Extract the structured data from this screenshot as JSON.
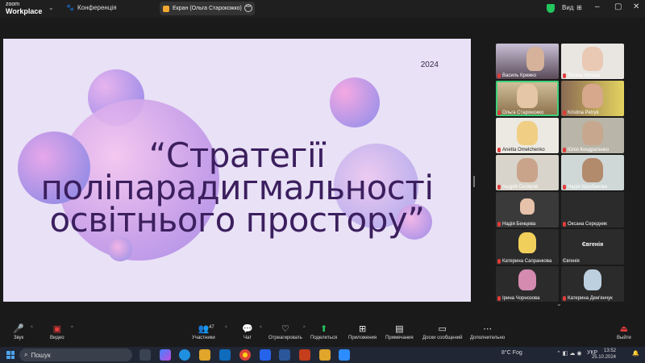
{
  "topbar": {
    "brand_line1": "zoom",
    "brand_line2": "Workplace",
    "conference_label": "Конференція",
    "screen_share_label": "Екран (Ольга Старокожко)",
    "view_label": "Вид",
    "icons": [
      "chevron-down-icon",
      "paw-icon",
      "shield-check-icon",
      "grid-icon",
      "minimize-icon",
      "maximize-icon",
      "close-icon"
    ]
  },
  "slide": {
    "year": "2024",
    "title_line1": "“Стратегії",
    "title_line2": "поліпарадигмальності",
    "title_line3": "освітнього простору”"
  },
  "gallery": {
    "participants": [
      {
        "name": "Василь Крижко",
        "muted": true
      },
      {
        "name": "Тетяна Мухіна",
        "muted": true
      },
      {
        "name": "Ольга Старокожко",
        "muted": true
      },
      {
        "name": "Kristina Petryk",
        "muted": true
      },
      {
        "name": "Anetta Omelchenko",
        "muted": true
      },
      {
        "name": "Юлія Кондратенко",
        "muted": true
      },
      {
        "name": "Андрій Скляров",
        "muted": true
      },
      {
        "name": "Надія Щербакова",
        "muted": true
      },
      {
        "name": "Надія Бенцева",
        "muted": true
      },
      {
        "name": "Оксана Середняк",
        "muted": true
      },
      {
        "name": "Катерина Сапранкова",
        "muted": true
      },
      {
        "name": "Євгенія",
        "muted": false,
        "center_name": "Євгенія"
      },
      {
        "name": "Ірина Чорнозова",
        "muted": true
      },
      {
        "name": "Катерина Дем'янчук",
        "muted": true
      }
    ]
  },
  "toolbar": {
    "audio": "Звук",
    "video": "Видео",
    "participants": "Участники",
    "participants_count": "47",
    "chat": "Чат",
    "react": "Отреагировать",
    "share": "Поделиться",
    "apps": "Приложения",
    "notes": "Примечания",
    "whiteboards": "Доски сообщений",
    "more": "Дополнительно",
    "leave": "Выйти"
  },
  "taskbar": {
    "search_placeholder": "Пошук",
    "weather": "8°C  Fog",
    "language": "УКР",
    "time": "13:52",
    "date": "25.10.2024"
  },
  "colors": {
    "slide_bg": "#e9e1f6",
    "title_color": "#3b1f5e",
    "active_outline": "#3fd07a",
    "muted_red": "#e03c3c"
  }
}
